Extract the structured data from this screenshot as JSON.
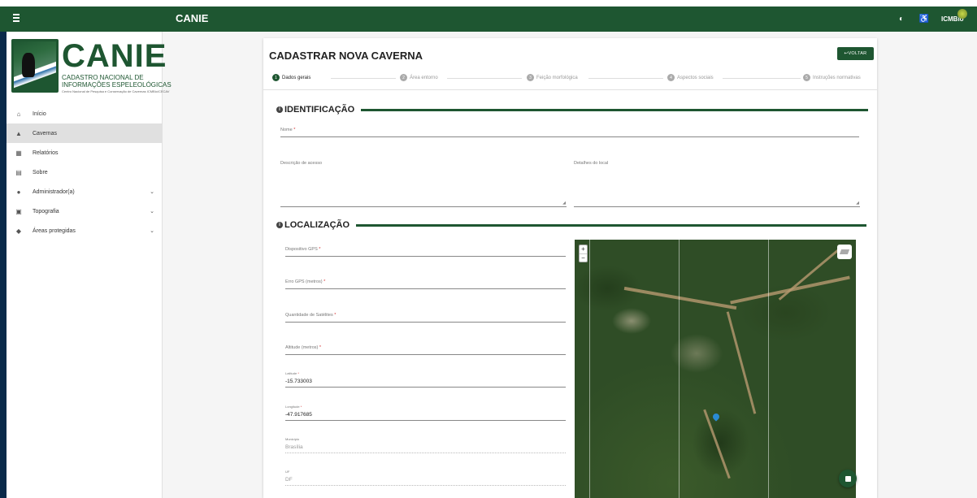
{
  "appbar": {
    "title": "CANIE",
    "brand": "ICMBio"
  },
  "logo": {
    "big": "CANIE",
    "sub1": "CADASTRO NACIONAL DE",
    "sub2": "INFORMAÇÕES ESPELEOLÓGICAS",
    "sub3": "Centro Nacional de Pesquisa e Conservação de Cavernas ICMBio/CECAV"
  },
  "sidebar": {
    "items": [
      {
        "label": "Início",
        "icon": "home-icon"
      },
      {
        "label": "Cavernas",
        "icon": "mountain-icon",
        "active": true
      },
      {
        "label": "Relatórios",
        "icon": "chart-icon"
      },
      {
        "label": "Sobre",
        "icon": "forum-icon"
      },
      {
        "label": "Administrador(a)",
        "icon": "person-icon",
        "expandable": true
      },
      {
        "label": "Topografia",
        "icon": "folder-icon",
        "expandable": true
      },
      {
        "label": "Áreas protegidas",
        "icon": "shield-icon",
        "expandable": true
      }
    ]
  },
  "page": {
    "title": "CADASTRAR NOVA CAVERNA",
    "back_label": "VOLTAR",
    "steps": [
      {
        "num": "1",
        "label": "Dados gerais"
      },
      {
        "num": "2",
        "label": "Área entorno"
      },
      {
        "num": "3",
        "label": "Feição morfológica"
      },
      {
        "num": "4",
        "label": "Aspectos sociais"
      },
      {
        "num": "5",
        "label": "Instruções normativas"
      }
    ]
  },
  "identificacao": {
    "heading": "IDENTIFICAÇÃO",
    "nome_label": "Nome",
    "descricao_label": "Descrição de acesso",
    "detalhes_label": "Detalhes do local"
  },
  "localizacao": {
    "heading": "LOCALIZAÇÃO",
    "gps_label": "Dispositivo GPS",
    "erro_label": "Erro GPS (metros)",
    "satelites_label": "Quantidade de Satélites",
    "altitude_label": "Altitude (metros)",
    "latitude_label": "Latitude",
    "latitude_value": "-15.733003",
    "longitude_label": "Longitude",
    "longitude_value": "-47.917685",
    "municipio_label": "Município",
    "municipio_value": "Brasília",
    "uf_label": "UF",
    "uf_value": "DF"
  },
  "colors": {
    "primary": "#1e5631",
    "required": "#d32f2f"
  }
}
